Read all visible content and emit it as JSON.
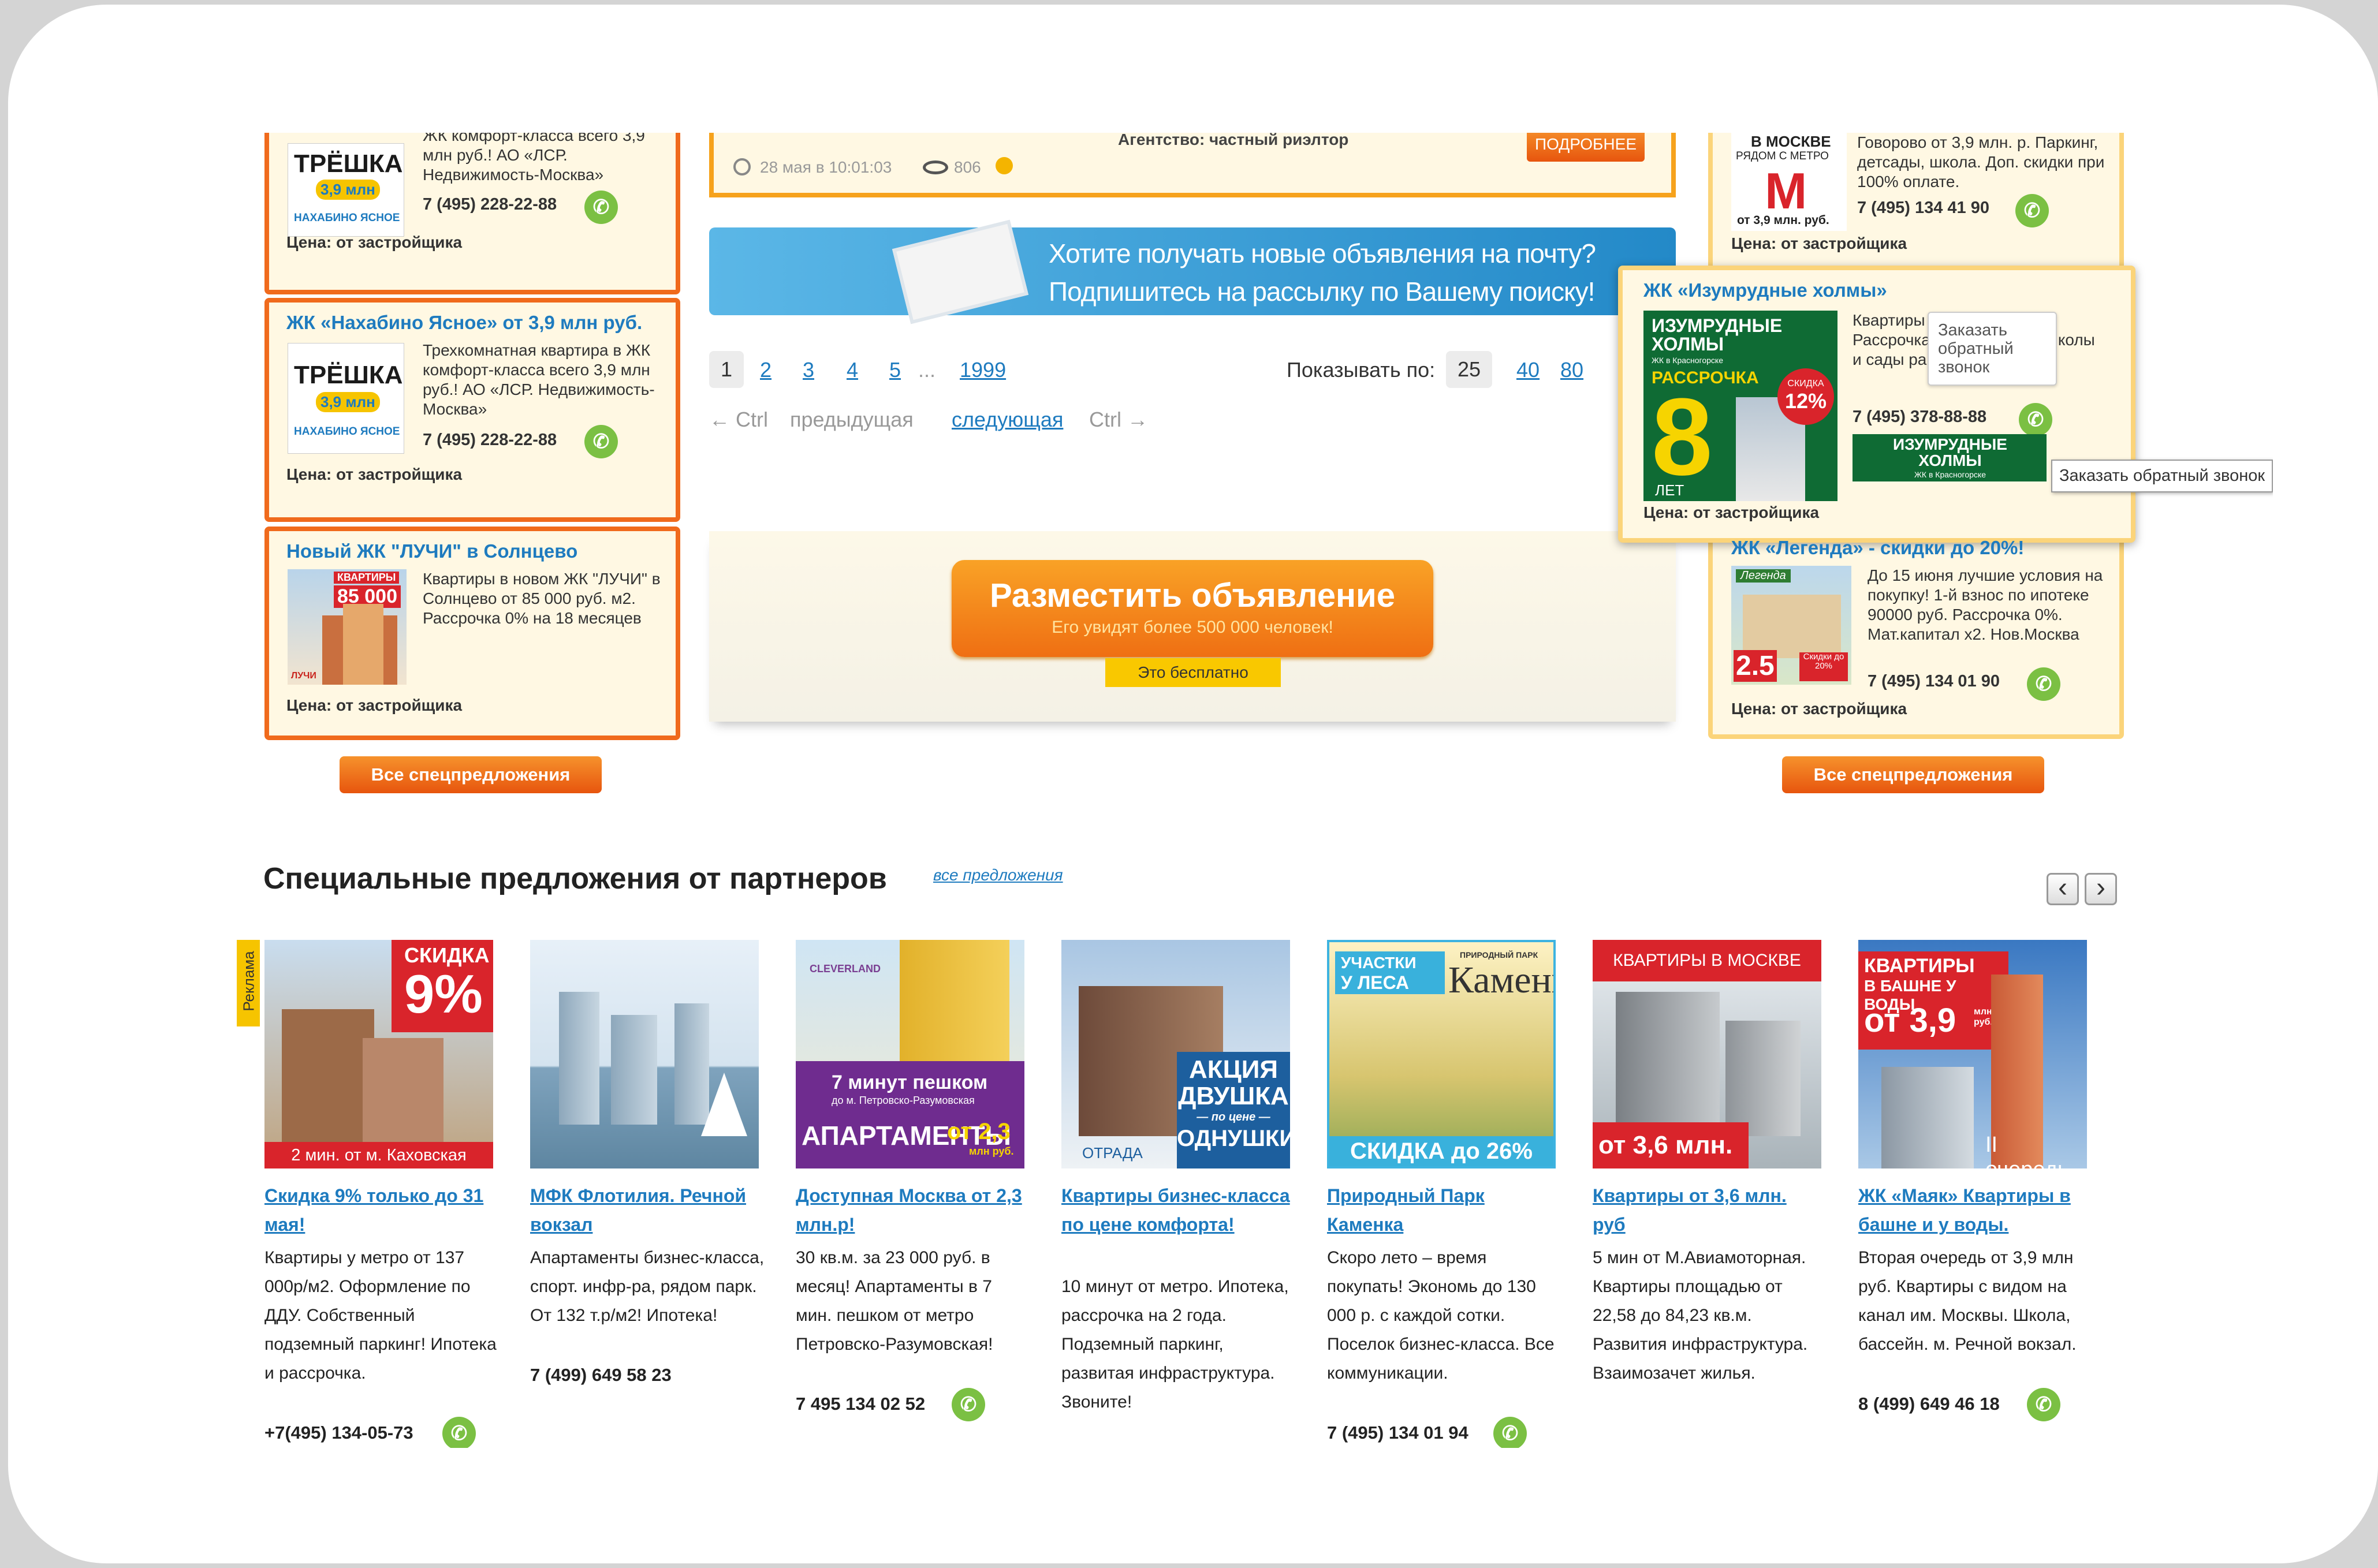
{
  "top_listing": {
    "agency_partial": "Агентство:  частный риэлтор",
    "date": "28 мая в 10:01:03",
    "views": "806",
    "more_button": "ПОДРОБНЕЕ"
  },
  "left_ads": [
    {
      "title": "",
      "thumb_big": "ТРЁШКА!",
      "thumb_price": "3,9 млн",
      "thumb_brand": "НАХАБИНО ЯСНОЕ",
      "text": "ЖК комфорт-класса всего 3,9 млн руб.! АО «ЛСР. Недвижимость-Москва»",
      "phone": "7 (495) 228-22-88",
      "price": "Цена: от застройщика"
    },
    {
      "title": "ЖК «Нахабино Ясное» от 3,9 млн руб.",
      "thumb_big": "ТРЁШКА!",
      "thumb_price": "3,9 млн",
      "thumb_brand": "НАХАБИНО ЯСНОЕ",
      "text": "Трехкомнатная квартира в ЖК комфорт-класса всего 3,9 млн руб.! АО «ЛСР. Недвижимость-Москва»",
      "phone": "7 (495) 228-22-88",
      "price": "Цена: от застройщика"
    },
    {
      "title": "Новый ЖК \"ЛУЧИ\" в Солнцево",
      "thumb_tag": "КВАРТИРЫ",
      "thumb_price": "85 000",
      "thumb_brand": "ЛУЧИ",
      "text": "Квартиры в новом ЖК \"ЛУЧИ\" в Солнцево от 85 000 руб. м2. Рассрочка 0% на 18 месяцев",
      "price": "Цена: от застройщика"
    }
  ],
  "right_ads": [
    {
      "thumb_top": "В МОСКВЕ",
      "thumb_sub": "РЯДОМ С МЕТРО",
      "thumb_bottom": "от 3,9 млн. руб.",
      "text": "Говорово от 3,9 млн. р. Паркинг, детсады, школа. Доп. скидки при 100% оплате.",
      "phone": "7 (495) 134 41 90",
      "price": "Цена: от застройщика"
    },
    {
      "title": "ЖК «Изумрудные холмы»",
      "thumb_brand": "ИЗУМРУДНЫЕ ХОЛМЫ",
      "thumb_sub": "ЖК в Красногорске",
      "thumb_tag": "РАССРОЧКА",
      "thumb_big": "8",
      "thumb_years": "ЛЕТ",
      "thumb_discount": "СКИДКА",
      "thumb_discount_val": "12%",
      "text": "Квартиры от застройщика. Рассрочка 8 лет. Скидки. Школы и сады работают.",
      "tooltip": "Заказать обратный звонок",
      "phone": "7 (495) 378-88-88",
      "price": "Цена: от застройщика",
      "logo_text": "ИЗУМРУДНЫЕ ХОЛМЫ",
      "logo_sub": "ЖК в Красногорске",
      "hover_tip": "Заказать обратный звонок"
    },
    {
      "title": "ЖК «Легенда» - скидки до 20%!",
      "thumb_logo": "Легенда",
      "thumb_big": "2.5",
      "thumb_discount": "Скидки до 20%",
      "text": "До 15 июня лучшие условия на покупку! 1-й взнос по ипотеке 90000 руб. Рассрочка 0%. Мат.капитал х2. Нов.Москва",
      "phone": "7 (495) 134 01 90",
      "price": "Цена: от застройщика"
    }
  ],
  "subscribe": {
    "line1": "Хотите получать новые объявления на почту?",
    "line2": "Подпишитесь на рассылку по Вашему поиску!"
  },
  "pagination": {
    "pages": [
      "1",
      "2",
      "3",
      "4",
      "5"
    ],
    "ellipsis": "...",
    "last": "1999",
    "show_label": "Показывать по:",
    "per_page": [
      "25",
      "40",
      "80"
    ],
    "prev_key": "← Ctrl",
    "prev": "предыдущая",
    "next": "следующая",
    "next_key": "Ctrl →"
  },
  "post_ad": {
    "title": "Разместить объявление",
    "subtitle": "Его увидят более 500 000 человек!",
    "free": "Это бесплатно"
  },
  "all_offers_left": "Все спецпредложения",
  "all_offers_right": "Все спецпредложения",
  "partners": {
    "heading": "Специальные предложения от партнеров",
    "all_link": "все предложения",
    "ad_label": "Реклама",
    "prev": "‹",
    "next": "›",
    "items": [
      {
        "img_a": "СКИДКА",
        "img_b": "9%",
        "img_c": "2 мин. от м. Каховская",
        "title": "Скидка 9% только до 31 мая!",
        "text": "Квартиры у метро от 137 000р/м2. Оформление по ДДУ. Собственный подземный паркинг! Ипотека и рассрочка.",
        "phone": "+7(495) 134-05-73"
      },
      {
        "title": "МФК Флотилия. Речной вокзал",
        "text": "Апартаменты бизнес-класса, спорт. инфр-ра, рядом парк. От 132 т.р/м2! Ипотека!",
        "phone": "7 (499) 649 58 23"
      },
      {
        "img_a": "CLEVERLAND",
        "img_b": "7 минут пешком",
        "img_c": "до м. Петровско-Разумовская",
        "img_d": "АПАРТАМЕНТЫ",
        "img_e": "от 2,3",
        "img_f": "млн руб.",
        "title": "Доступная Москва от 2,3 млн.р!",
        "text": "30 кв.м. за 23 000 руб. в месяц! Апартаменты в 7 мин. пешком от метро Петровско-Разумовская!",
        "phone": "7 495 134 02 52"
      },
      {
        "img_a": "АКЦИЯ",
        "img_b": "ДВУШКА",
        "img_c": "— по цене —",
        "img_d": "ОДНУШКИ!",
        "img_e": "ОТРАДА",
        "title": "Квартиры бизнес-класса по цене комфорта!",
        "text": "10 минут от метро. Ипотека, рассрочка на 2 года. Подземный паркинг, развитая инфраструктура. Звоните!"
      },
      {
        "img_a": "УЧАСТКИ",
        "img_b": "У ЛЕСА",
        "img_c": "ПРИРОДНЫЙ ПАРК",
        "img_d": "Каменка",
        "img_e": "СКИДКА до 26%",
        "title": "Природный Парк Каменка",
        "text": "Скоро лето – время покупать! Экономь до 130 000 р. с каждой сотки. Поселок бизнес-класса. Все коммуникации.",
        "phone": "7 (495) 134 01 94"
      },
      {
        "img_a": "КВАРТИРЫ В МОСКВЕ",
        "img_b": "от 3,6 млн. руб",
        "title": "Квартиры от 3,6 млн. руб",
        "text": "5 мин от М.Авиамоторная. Квартиры площадью от 22,58 до 84,23 кв.м. Развития инфраструктура. Взаимозачет жилья."
      },
      {
        "img_a": "КВАРТИРЫ",
        "img_b": "В БАШНЕ У ВОДЫ",
        "img_c": "от 3,9",
        "img_d": "млн руб.",
        "img_e": "II очередь",
        "title": "ЖК «Маяк» Квартиры в башне и у воды.",
        "text": "Вторая очередь от 3,9 млн руб. Квартиры с видом на канал им. Москвы. Школа, бассейн. м. Речной вокзал.",
        "phone": "8 (499) 649 46 18"
      }
    ]
  },
  "colors": {
    "accent_orange": "#f06a1c",
    "link_blue": "#1e7bbf",
    "card_bg": "#fff8e3",
    "call_green": "#7bc043",
    "right_border": "#fbd47a"
  }
}
